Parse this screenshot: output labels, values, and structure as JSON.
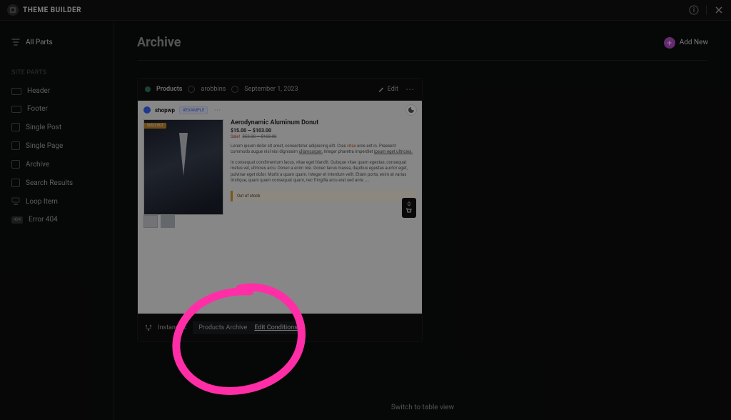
{
  "brand": "THEME BUILDER",
  "topbar": {
    "info_icon": "info-icon",
    "close_icon": "close-icon"
  },
  "sidebar": {
    "all_parts": "All Parts",
    "site_parts_label": "SITE PARTS",
    "items": [
      {
        "label": "Header"
      },
      {
        "label": "Footer"
      },
      {
        "label": "Single Post"
      },
      {
        "label": "Single Page"
      },
      {
        "label": "Archive"
      },
      {
        "label": "Search Results"
      },
      {
        "label": "Loop Item"
      },
      {
        "label": "Error 404"
      }
    ]
  },
  "page": {
    "title": "Archive",
    "add_new": "Add New",
    "switch_view": "Switch to table view"
  },
  "card": {
    "title": "Products",
    "author": "arobbins",
    "date": "September 1, 2023",
    "edit": "Edit",
    "instances_label": "Instances:",
    "instance_name": "Products Archive",
    "edit_conditions": "Edit Conditions"
  },
  "preview": {
    "brand": "shopwp",
    "badge": "#EXAMPLE",
    "sold_out": "SOLD OUT",
    "product_title": "Aerodynamic Aluminum Donut",
    "price": "$15.00 — $103.00",
    "sale_label": "Sale!",
    "price_old": "$52.00 — $103.00",
    "para1a": "Lorem ipsum dolor sit amet, consectetur adipiscing elit. Cras ",
    "para1b": "vitae",
    "para1c": " eros est in. Praesent commodo augue nisl nisi dignissim ",
    "para1d": "ullamcorper.",
    "para1e": " Integer pharetra imperdiet ",
    "para1f": "ipsum eget ultricies.",
    "para2": "In consequat condimentum lacus, vitae eget blandit. Quisque vitae quam egestas, consequat metus vel, ultricies arcu. Donec a enim nisi. Donec lacus massa, dapibus egestas auctor eget, pulvinar eget dolor. Morbi a quam quam. Integer et interdum velit. Etiam porta, enim at varius tristique, quam quam consequat quam, nec fringilla arcu erat sed ante …..",
    "out_of_stock": "Out of stock",
    "cart_count": "0"
  }
}
